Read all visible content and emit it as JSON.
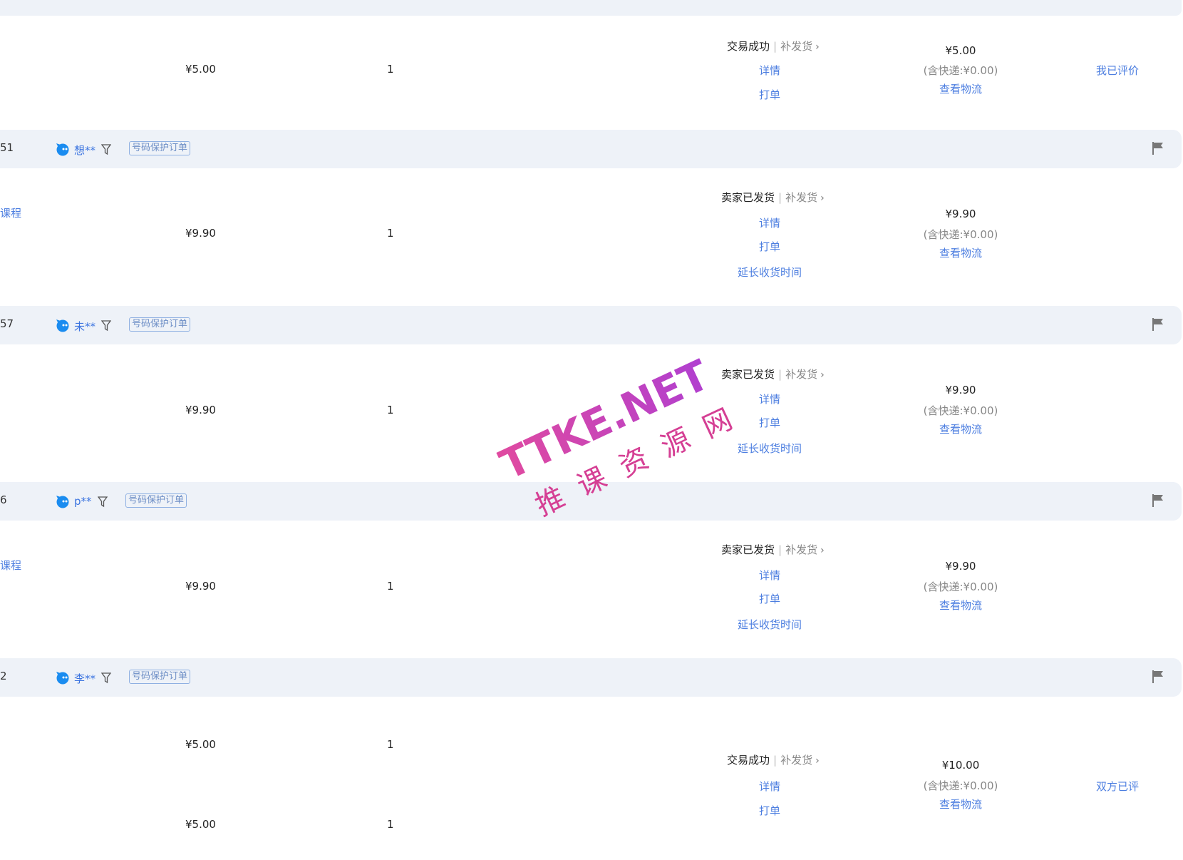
{
  "orders": [
    {
      "id_fragment": "",
      "buyer": "",
      "product_link": "",
      "rows": [
        {
          "price": "¥5.00",
          "qty": "1"
        }
      ],
      "status": "交易成功",
      "resend": "补发货",
      "actions": [
        "详情",
        "打单"
      ],
      "total": "¥5.00",
      "shipping": "(含快递:¥0.00)",
      "logistics": "查看物流",
      "review": "我已评价"
    },
    {
      "id_fragment": "51",
      "buyer": "想**",
      "badge": "号码保护订单",
      "product_link": "课程",
      "rows": [
        {
          "price": "¥9.90",
          "qty": "1"
        }
      ],
      "status": "卖家已发货",
      "resend": "补发货",
      "actions": [
        "详情",
        "打单",
        "延长收货时间"
      ],
      "total": "¥9.90",
      "shipping": "(含快递:¥0.00)",
      "logistics": "查看物流",
      "review": ""
    },
    {
      "id_fragment": "57",
      "buyer": "未**",
      "badge": "号码保护订单",
      "product_link": "",
      "rows": [
        {
          "price": "¥9.90",
          "qty": "1"
        }
      ],
      "status": "卖家已发货",
      "resend": "补发货",
      "actions": [
        "详情",
        "打单",
        "延长收货时间"
      ],
      "total": "¥9.90",
      "shipping": "(含快递:¥0.00)",
      "logistics": "查看物流",
      "review": ""
    },
    {
      "id_fragment": "6",
      "buyer": "p**",
      "badge": "号码保护订单",
      "product_link": "课程",
      "rows": [
        {
          "price": "¥9.90",
          "qty": "1"
        }
      ],
      "status": "卖家已发货",
      "resend": "补发货",
      "actions": [
        "详情",
        "打单",
        "延长收货时间"
      ],
      "total": "¥9.90",
      "shipping": "(含快递:¥0.00)",
      "logistics": "查看物流",
      "review": ""
    },
    {
      "id_fragment": "2",
      "buyer": "李**",
      "badge": "号码保护订单",
      "product_link": "",
      "rows": [
        {
          "price": "¥5.00",
          "qty": "1"
        },
        {
          "price": "¥5.00",
          "qty": "1"
        }
      ],
      "status": "交易成功",
      "resend": "补发货",
      "actions": [
        "详情",
        "打单"
      ],
      "total": "¥10.00",
      "shipping": "(含快递:¥0.00)",
      "logistics": "查看物流",
      "review": "双方已评"
    }
  ],
  "watermark": {
    "line1": "TTKE.NET",
    "line2": "推 课 资 源 网"
  }
}
